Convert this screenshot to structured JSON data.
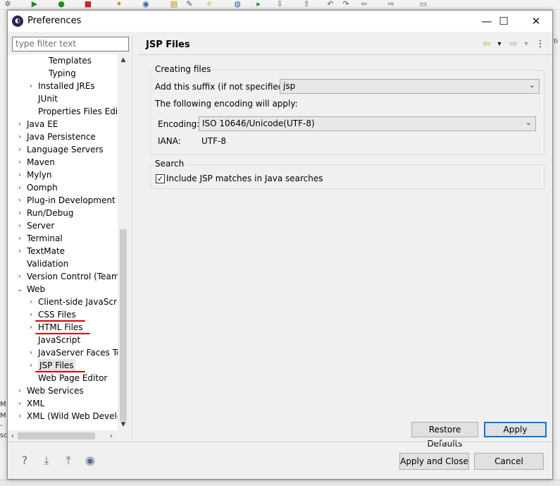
{
  "background": {
    "edge_texts": [
      "M",
      "M",
      "-",
      "sc"
    ]
  },
  "window": {
    "title": "Preferences",
    "controls": {
      "minimize": "—",
      "maximize": "☐",
      "close": "✕"
    }
  },
  "filter": {
    "placeholder": "type filter text"
  },
  "tree": [
    {
      "label": "Templates",
      "level": 3,
      "chevron": false
    },
    {
      "label": "Typing",
      "level": 3,
      "chevron": false
    },
    {
      "label": "Installed JREs",
      "level": 2,
      "chevron": true
    },
    {
      "label": "JUnit",
      "level": 2,
      "chevron": false
    },
    {
      "label": "Properties Files Edito",
      "level": 2,
      "chevron": false
    },
    {
      "label": "Java EE",
      "level": 1,
      "chevron": true
    },
    {
      "label": "Java Persistence",
      "level": 1,
      "chevron": true
    },
    {
      "label": "Language Servers",
      "level": 1,
      "chevron": true
    },
    {
      "label": "Maven",
      "level": 1,
      "chevron": true
    },
    {
      "label": "Mylyn",
      "level": 1,
      "chevron": true
    },
    {
      "label": "Oomph",
      "level": 1,
      "chevron": true
    },
    {
      "label": "Plug-in Development",
      "level": 1,
      "chevron": true
    },
    {
      "label": "Run/Debug",
      "level": 1,
      "chevron": true
    },
    {
      "label": "Server",
      "level": 1,
      "chevron": true
    },
    {
      "label": "Terminal",
      "level": 1,
      "chevron": true
    },
    {
      "label": "TextMate",
      "level": 1,
      "chevron": true
    },
    {
      "label": "Validation",
      "level": 1,
      "chevron": false
    },
    {
      "label": "Version Control (Team)",
      "level": 1,
      "chevron": true
    },
    {
      "label": "Web",
      "level": 1,
      "chevron": true,
      "expanded": true
    },
    {
      "label": "Client-side JavaScript",
      "level": 2,
      "chevron": true
    },
    {
      "label": "CSS Files",
      "level": 2,
      "chevron": true,
      "underlined": true
    },
    {
      "label": "HTML Files",
      "level": 2,
      "chevron": true,
      "underlined": true
    },
    {
      "label": "JavaScript",
      "level": 2,
      "chevron": false
    },
    {
      "label": "JavaServer Faces Too",
      "level": 2,
      "chevron": true
    },
    {
      "label": "JSP Files",
      "level": 2,
      "chevron": true,
      "selected": true,
      "underlined": true
    },
    {
      "label": "Web Page Editor",
      "level": 2,
      "chevron": false
    },
    {
      "label": "Web Services",
      "level": 1,
      "chevron": true
    },
    {
      "label": "XML",
      "level": 1,
      "chevron": true
    },
    {
      "label": "XML (Wild Web Develop",
      "level": 1,
      "chevron": true
    }
  ],
  "page": {
    "title": "JSP Files",
    "nav": {
      "back": "⇦",
      "forward": "⇨",
      "menu": "⋮",
      "dropdown": "▾"
    },
    "creating_files": {
      "title": "Creating files",
      "suffix_label": "Add this suffix (if not specified):",
      "suffix_value": "jsp",
      "encoding_intro": "The following encoding will apply:",
      "encoding_label": "Encoding:",
      "encoding_value": "ISO 10646/Unicode(UTF-8)",
      "iana_label": "IANA:",
      "iana_value": "UTF-8"
    },
    "search": {
      "title": "Search",
      "checkbox_label": "Include JSP matches in Java searches",
      "checked": true
    },
    "restore_defaults": "Restore Defaults",
    "apply": "Apply"
  },
  "footer": {
    "apply_and_close": "Apply and Close",
    "cancel": "Cancel"
  },
  "colors": {
    "accent": "#0078d7",
    "annotation_red": "#e00000",
    "selection": "#e5e5e5"
  }
}
